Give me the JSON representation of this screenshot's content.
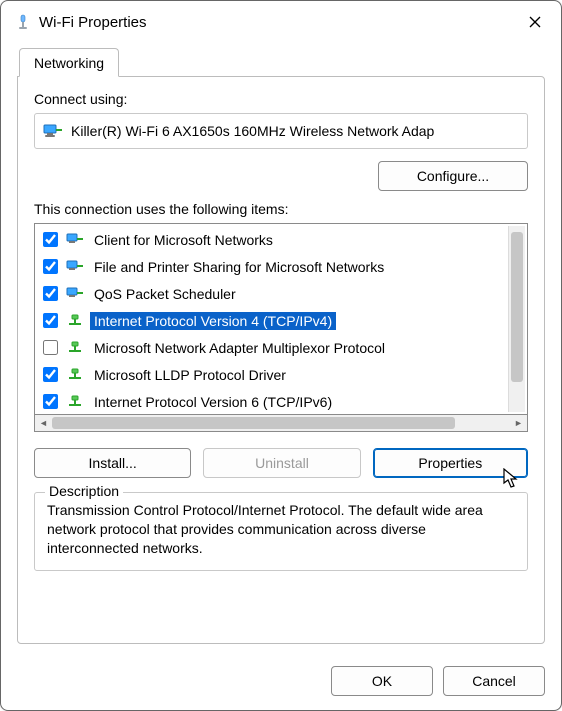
{
  "window": {
    "title": "Wi-Fi Properties"
  },
  "tabs": {
    "networking": "Networking"
  },
  "connect_using_label": "Connect using:",
  "adapter_name": "Killer(R) Wi-Fi 6 AX1650s 160MHz Wireless Network Adap",
  "configure_button": "Configure...",
  "items_label": "This connection uses the following items:",
  "items": [
    {
      "label": "Client for Microsoft Networks",
      "checked": true,
      "icon": "client",
      "selected": false
    },
    {
      "label": "File and Printer Sharing for Microsoft Networks",
      "checked": true,
      "icon": "client",
      "selected": false
    },
    {
      "label": "QoS Packet Scheduler",
      "checked": true,
      "icon": "client",
      "selected": false
    },
    {
      "label": "Internet Protocol Version 4 (TCP/IPv4)",
      "checked": true,
      "icon": "proto",
      "selected": true
    },
    {
      "label": "Microsoft Network Adapter Multiplexor Protocol",
      "checked": false,
      "icon": "proto",
      "selected": false
    },
    {
      "label": "Microsoft LLDP Protocol Driver",
      "checked": true,
      "icon": "proto",
      "selected": false
    },
    {
      "label": "Internet Protocol Version 6 (TCP/IPv6)",
      "checked": true,
      "icon": "proto",
      "selected": false
    }
  ],
  "buttons": {
    "install": "Install...",
    "uninstall": "Uninstall",
    "properties": "Properties",
    "ok": "OK",
    "cancel": "Cancel"
  },
  "description": {
    "legend": "Description",
    "text": "Transmission Control Protocol/Internet Protocol. The default wide area network protocol that provides communication across diverse interconnected networks."
  }
}
